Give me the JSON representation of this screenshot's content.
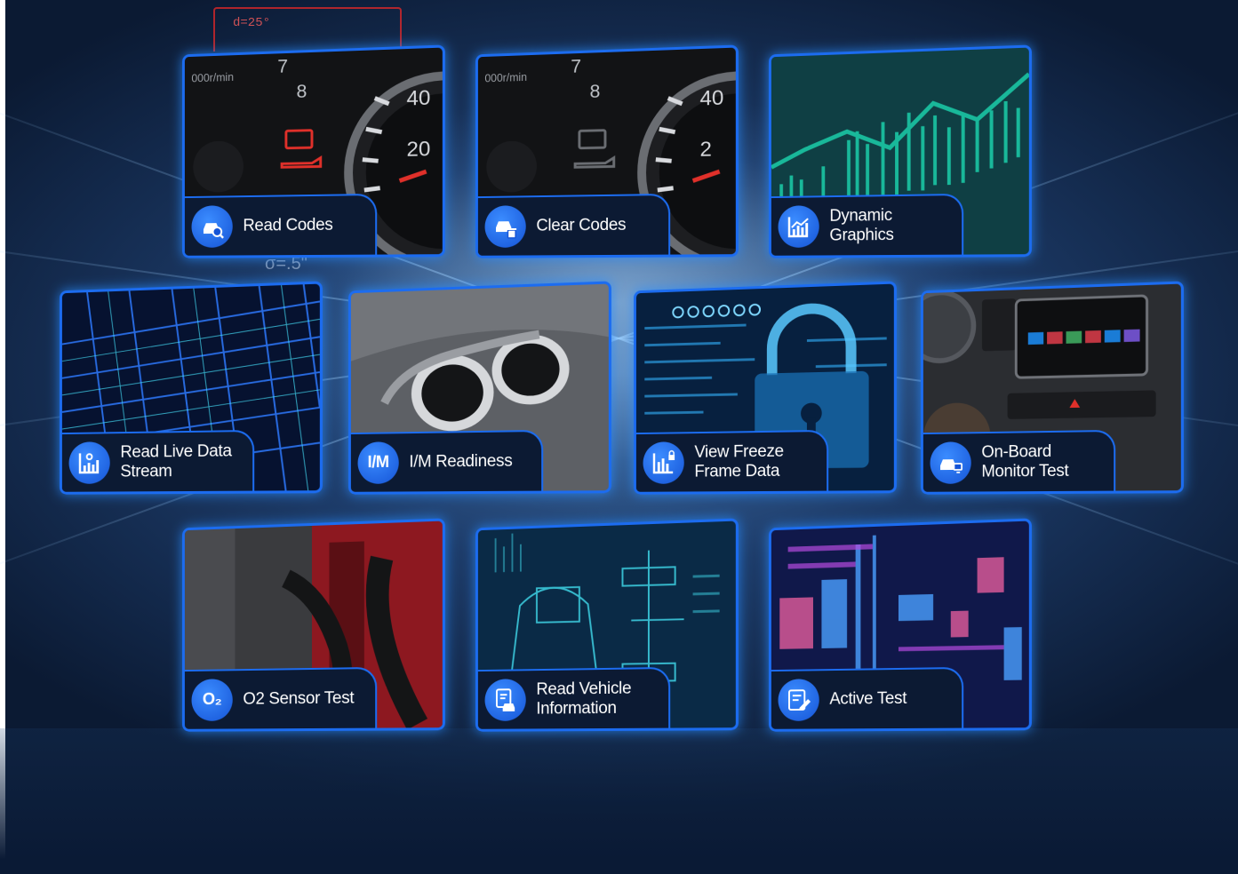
{
  "background": {
    "hud_text": "d=25°",
    "sigma_text": "σ=.5\""
  },
  "tiles": [
    {
      "label": "Read Codes",
      "icon": "car-search-icon",
      "scene": "dashboard-warning-lights"
    },
    {
      "label": "Clear Codes",
      "icon": "car-delete-icon",
      "scene": "dashboard-lights-off"
    },
    {
      "label": "Dynamic\nGraphics",
      "icon": "chart-icon",
      "scene": "teal-line-chart"
    },
    {
      "label": "Read Live Data\nStream",
      "icon": "live-data-chart-icon",
      "scene": "blue-data-grid"
    },
    {
      "label": "I/M Readiness",
      "icon_text": "I/M",
      "icon": "im-icon",
      "scene": "exhaust-pipes"
    },
    {
      "label": "View Freeze\nFrame Data",
      "icon": "locked-bar-chart-icon",
      "scene": "digital-padlock"
    },
    {
      "label": "On-Board\nMonitor Test",
      "icon": "car-monitor-icon",
      "scene": "car-infotainment"
    },
    {
      "label": "O2 Sensor Test",
      "icon_text": "O₂",
      "icon": "o2-icon",
      "scene": "engine-bay"
    },
    {
      "label": "Read Vehicle\nInformation",
      "icon": "vehicle-info-icon",
      "scene": "vehicle-blueprint"
    },
    {
      "label": "Active Test",
      "icon": "edit-document-icon",
      "scene": "data-city"
    }
  ],
  "colors": {
    "tile_border": "#1c6cf0",
    "icon_bg": "#1554d6",
    "label_bg": "#0c1a33",
    "chart_teal": "#19b89a",
    "warning_red": "#e0302a"
  }
}
